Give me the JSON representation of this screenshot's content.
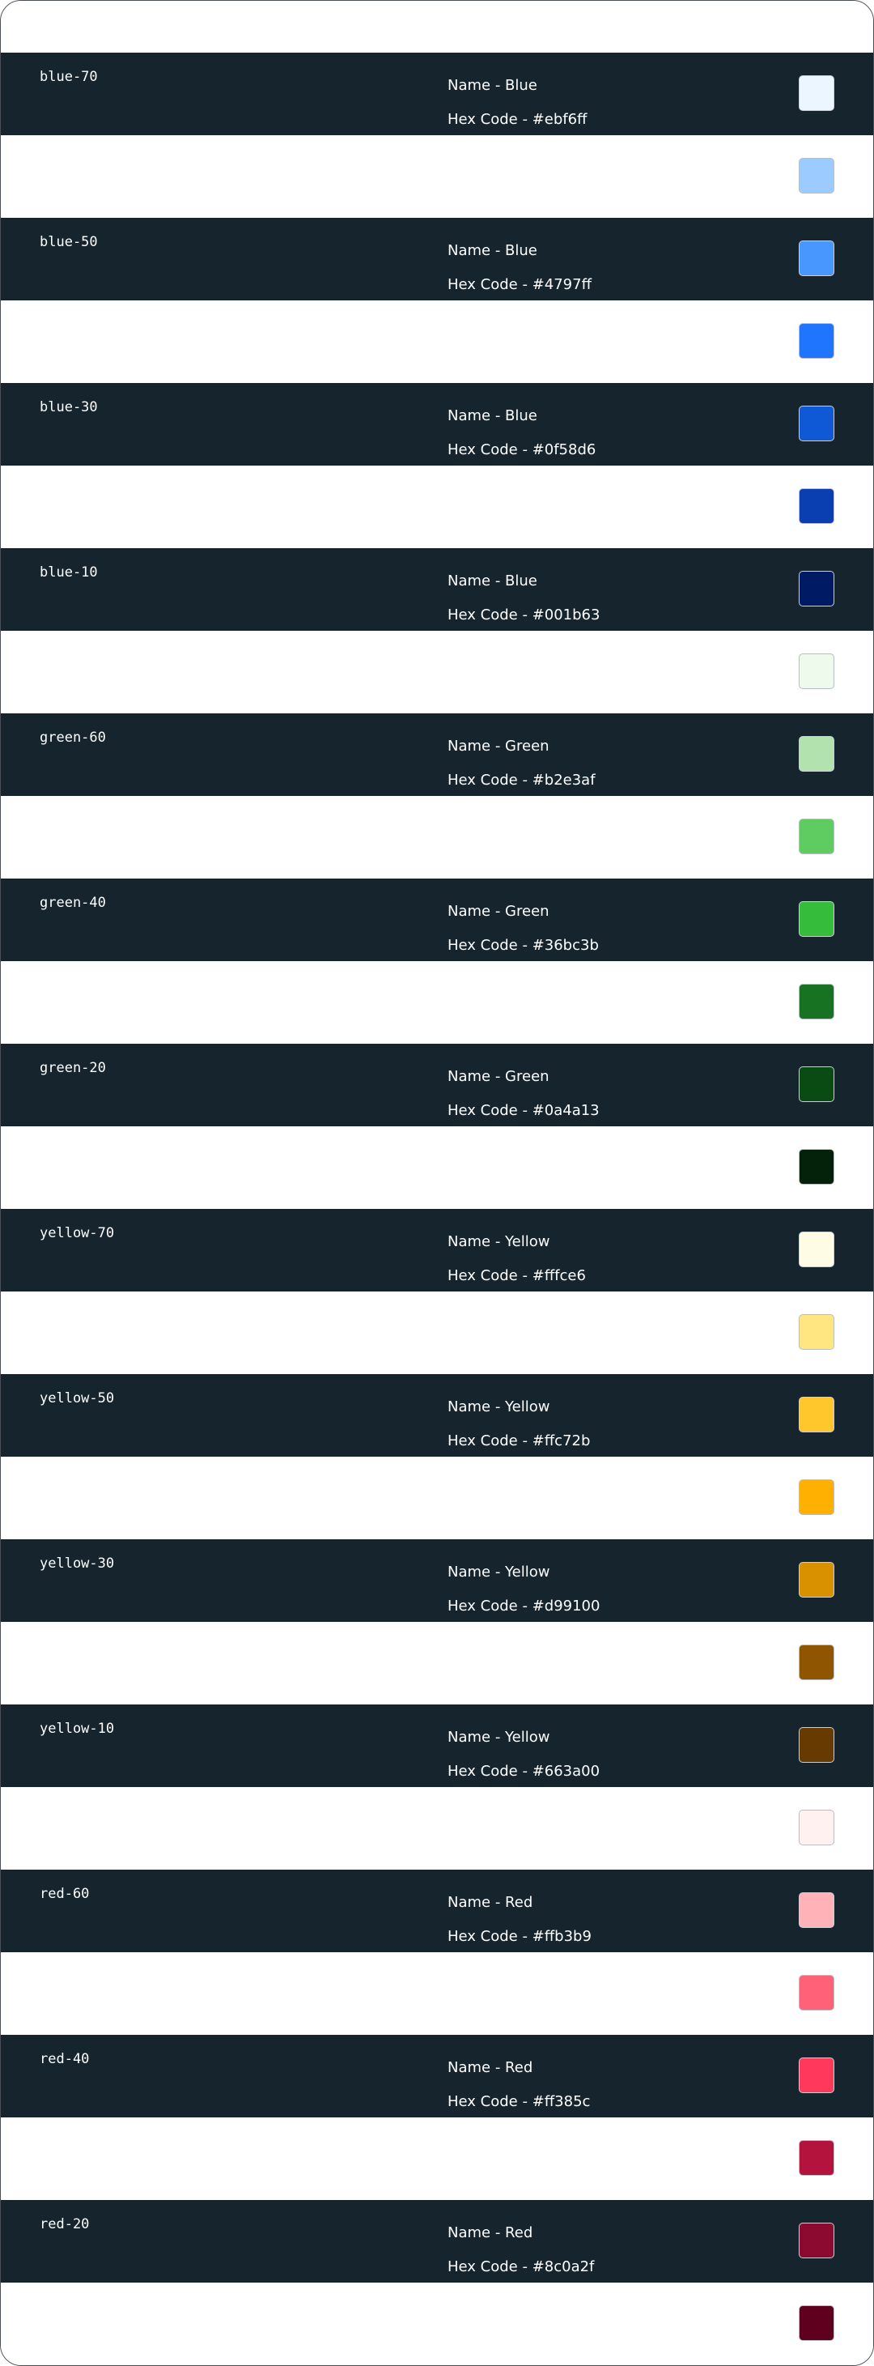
{
  "rows": [
    {
      "token": "blue-70",
      "name_line": "Name - Blue",
      "hex_line": "Hex Code - #ebf6ff",
      "color": "#ebf6ff",
      "dark": true
    },
    {
      "token": "",
      "name_line": "",
      "hex_line": "",
      "color": "#9ccbff",
      "dark": false
    },
    {
      "token": "blue-50",
      "name_line": "Name - Blue",
      "hex_line": "Hex Code - #4797ff",
      "color": "#4797ff",
      "dark": true
    },
    {
      "token": "",
      "name_line": "",
      "hex_line": "",
      "color": "#1f75fe",
      "dark": false
    },
    {
      "token": "blue-30",
      "name_line": "Name - Blue",
      "hex_line": "Hex Code - #0f58d6",
      "color": "#0f58d6",
      "dark": true
    },
    {
      "token": "",
      "name_line": "",
      "hex_line": "",
      "color": "#0a3fb2",
      "dark": false
    },
    {
      "token": "blue-10",
      "name_line": "Name - Blue",
      "hex_line": "Hex Code - #001b63",
      "color": "#001b63",
      "dark": true
    },
    {
      "token": "",
      "name_line": "",
      "hex_line": "",
      "color": "#eefaeb",
      "dark": false
    },
    {
      "token": "green-60",
      "name_line": "Name - Green",
      "hex_line": "Hex Code - #b2e3af",
      "color": "#b2e3af",
      "dark": true
    },
    {
      "token": "",
      "name_line": "",
      "hex_line": "",
      "color": "#5fcc62",
      "dark": false
    },
    {
      "token": "green-40",
      "name_line": "Name - Green",
      "hex_line": "Hex Code - #36bc3b",
      "color": "#36bc3b",
      "dark": true
    },
    {
      "token": "",
      "name_line": "",
      "hex_line": "",
      "color": "#177322",
      "dark": false
    },
    {
      "token": "green-20",
      "name_line": "Name - Green",
      "hex_line": "Hex Code - #0a4a13",
      "color": "#0a4a13",
      "dark": true
    },
    {
      "token": "",
      "name_line": "",
      "hex_line": "",
      "color": "#04210a",
      "dark": false
    },
    {
      "token": "yellow-70",
      "name_line": "Name - Yellow",
      "hex_line": "Hex Code - #fffce6",
      "color": "#fffce6",
      "dark": true
    },
    {
      "token": "",
      "name_line": "",
      "hex_line": "",
      "color": "#ffe680",
      "dark": false
    },
    {
      "token": "yellow-50",
      "name_line": "Name - Yellow",
      "hex_line": "Hex Code - #ffc72b",
      "color": "#ffc72b",
      "dark": true
    },
    {
      "token": "",
      "name_line": "",
      "hex_line": "",
      "color": "#ffb000",
      "dark": false
    },
    {
      "token": "yellow-30",
      "name_line": "Name - Yellow",
      "hex_line": "Hex Code - #d99100",
      "color": "#d99100",
      "dark": true
    },
    {
      "token": "",
      "name_line": "",
      "hex_line": "",
      "color": "#8f5500",
      "dark": false
    },
    {
      "token": "yellow-10",
      "name_line": "Name - Yellow",
      "hex_line": "Hex Code - #663a00",
      "color": "#663a00",
      "dark": true
    },
    {
      "token": "",
      "name_line": "",
      "hex_line": "",
      "color": "#fff1f0",
      "dark": false
    },
    {
      "token": "red-60",
      "name_line": "Name - Red",
      "hex_line": "Hex Code - #ffb3b9",
      "color": "#ffb3b9",
      "dark": true
    },
    {
      "token": "",
      "name_line": "",
      "hex_line": "",
      "color": "#ff6178",
      "dark": false
    },
    {
      "token": "red-40",
      "name_line": "Name - Red",
      "hex_line": "Hex Code - #ff385c",
      "color": "#ff385c",
      "dark": true
    },
    {
      "token": "",
      "name_line": "",
      "hex_line": "",
      "color": "#b4133e",
      "dark": false
    },
    {
      "token": "red-20",
      "name_line": "Name - Red",
      "hex_line": "Hex Code - #8c0a2f",
      "color": "#8c0a2f",
      "dark": true
    },
    {
      "token": "",
      "name_line": "",
      "hex_line": "",
      "color": "#60001f",
      "dark": false
    }
  ]
}
